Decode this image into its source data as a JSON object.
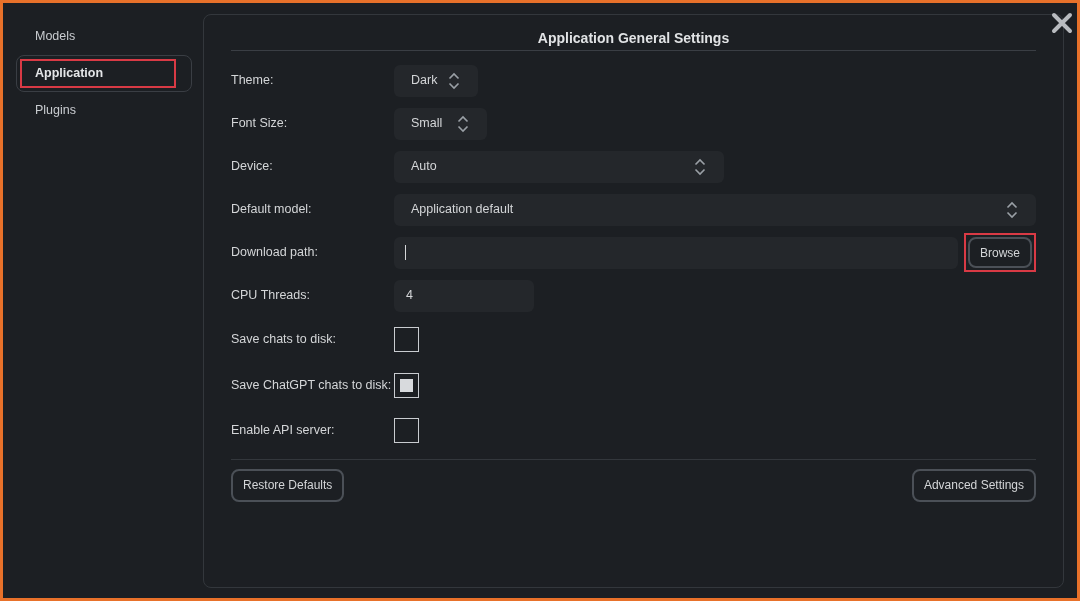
{
  "sidebar": {
    "items": [
      {
        "label": "Models",
        "selected": false,
        "annotated": false
      },
      {
        "label": "Application",
        "selected": true,
        "annotated": true
      },
      {
        "label": "Plugins",
        "selected": false,
        "annotated": false
      }
    ]
  },
  "panel": {
    "title": "Application General Settings",
    "settings": [
      {
        "kind": "select",
        "label": "Theme:",
        "value": "Dark"
      },
      {
        "kind": "select",
        "label": "Font Size:",
        "value": "Small"
      },
      {
        "kind": "select",
        "label": "Device:",
        "value": "Auto"
      },
      {
        "kind": "select",
        "label": "Default model:",
        "value": "Application default"
      },
      {
        "kind": "path",
        "label": "Download path:",
        "focused": true,
        "button": {
          "label": "Browse",
          "annotated": true
        }
      },
      {
        "kind": "input",
        "label": "CPU Threads:",
        "value": "4"
      },
      {
        "kind": "checkbox",
        "label": "Save chats to disk:",
        "checked": false
      },
      {
        "kind": "checkbox",
        "label": "Save ChatGPT chats to disk:",
        "checked": true
      },
      {
        "kind": "checkbox",
        "label": "Enable API server:",
        "checked": false
      }
    ],
    "buttons": [
      "Restore Defaults",
      "Advanced Settings"
    ]
  }
}
